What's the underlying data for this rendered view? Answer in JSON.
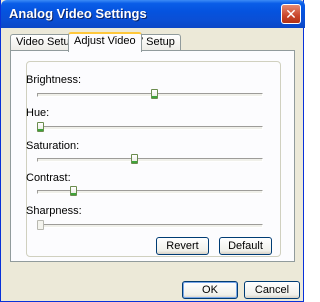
{
  "window": {
    "title": "Analog Video Settings"
  },
  "tabs": [
    {
      "label": "Video Setup"
    },
    {
      "label": "Adjust Video"
    },
    {
      "label": "TV Setup"
    }
  ],
  "sliders": [
    {
      "label": "Brightness:",
      "value": 0.52,
      "enabled": true
    },
    {
      "label": "Hue:",
      "value": 0.0,
      "enabled": true
    },
    {
      "label": "Saturation:",
      "value": 0.43,
      "enabled": true
    },
    {
      "label": "Contrast:",
      "value": 0.15,
      "enabled": true
    },
    {
      "label": "Sharpness:",
      "value": 0.0,
      "enabled": false
    }
  ],
  "buttons": {
    "revert": "Revert",
    "default": "Default",
    "ok": "OK",
    "cancel": "Cancel"
  },
  "icons": {
    "close": "close-icon"
  },
  "colors": {
    "titlebar": "#0553df",
    "tab_highlight": "#ffc83c",
    "thumb_accent": "#3ea43a"
  }
}
